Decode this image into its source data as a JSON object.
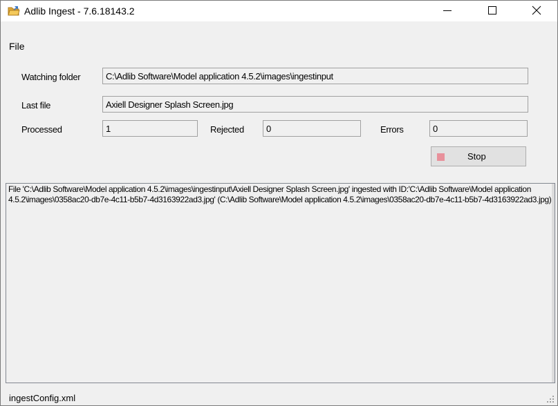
{
  "window": {
    "title": "Adlib Ingest - 7.6.18143.2",
    "app_icon": "folder-icon",
    "controls": {
      "minimize_icon": "minimize-icon",
      "maximize_icon": "maximize-icon",
      "close_icon": "close-icon"
    }
  },
  "menu": {
    "file_label": "File"
  },
  "form": {
    "watching_folder_label": "Watching folder",
    "watching_folder_value": "C:\\Adlib Software\\Model application 4.5.2\\images\\ingestinput",
    "last_file_label": "Last file",
    "last_file_value": "Axiell Designer Splash Screen.jpg",
    "processed_label": "Processed",
    "processed_value": "1",
    "rejected_label": "Rejected",
    "rejected_value": "0",
    "errors_label": "Errors",
    "errors_value": "0",
    "stop_button_label": "Stop",
    "stop_icon": "stop-square-icon",
    "stop_color": "#e8919b"
  },
  "log": {
    "text": "File 'C:\\Adlib Software\\Model application 4.5.2\\images\\ingestinput\\Axiell Designer Splash Screen.jpg' ingested with ID:'C:\\Adlib Software\\Model application 4.5.2\\images\\0358ac20-db7e-4c11-b5b7-4d3163922ad3.jpg' (C:\\Adlib Software\\Model application 4.5.2\\images\\0358ac20-db7e-4c11-b5b7-4d3163922ad3.jpg)"
  },
  "status": {
    "config_file": "ingestConfig.xml",
    "grip_icon": "resize-grip-icon"
  }
}
